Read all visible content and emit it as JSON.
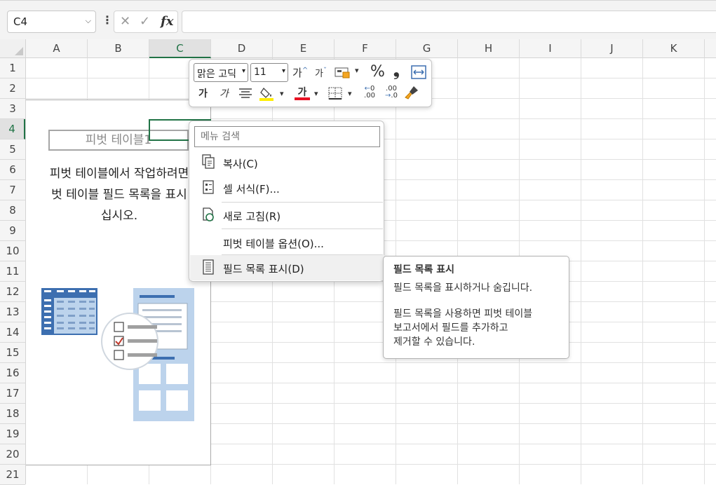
{
  "formula_bar": {
    "name_box": "C4",
    "cancel_glyph": "✕",
    "enter_glyph": "✓",
    "fx_label": "fx",
    "formula_value": ""
  },
  "columns": [
    "A",
    "B",
    "C",
    "D",
    "E",
    "F",
    "G",
    "H",
    "I",
    "J",
    "K"
  ],
  "selected_column": "C",
  "rows": [
    "1",
    "2",
    "3",
    "4",
    "5",
    "6",
    "7",
    "8",
    "9",
    "10",
    "11",
    "12",
    "13",
    "14",
    "15",
    "16",
    "17",
    "18",
    "19",
    "20",
    "21"
  ],
  "selected_row": "4",
  "pivot": {
    "title": "피벗 테이블1",
    "message_line1": "피벗 테이블에서 작업하려면",
    "message_line2": "벗 테이블 필드 목록을 표시",
    "message_line3": "십시오."
  },
  "mini_toolbar": {
    "font_name": "맑은 고딕",
    "font_size": "11",
    "grow_font": "가",
    "shrink_font": "가",
    "percent": "%",
    "comma": "❟",
    "bold": "가",
    "italic": "가",
    "font_color_glyph": "가",
    "increase_decimal": ".00",
    "decrease_decimal": ".00",
    "fill_color": "#ffee00",
    "font_color": "#e81123"
  },
  "context_menu": {
    "search_placeholder": "메뉴 검색",
    "items": [
      {
        "label": "복사(C)",
        "icon": "copy-icon"
      },
      {
        "label": "셀 서식(F)...",
        "icon": "format-cells-icon"
      },
      {
        "label": "새로 고침(R)",
        "icon": "refresh-icon"
      },
      {
        "label": "피벗 테이블 옵션(O)...",
        "icon": ""
      },
      {
        "label": "필드 목록 표시(D)",
        "icon": "field-list-icon"
      }
    ]
  },
  "tooltip": {
    "title": "필드 목록 표시",
    "line1": "필드 목록을 표시하거나 숨깁니다.",
    "line2a": "필드 목록을 사용하면 피벗 테이블",
    "line2b": "보고서에서 필드를 추가하고",
    "line2c": "제거할 수 있습니다."
  },
  "colors": {
    "accent": "#217346",
    "illustration_blue": "#3d6fb0",
    "illustration_light": "#bcd3ec",
    "check_red": "#c0392b"
  }
}
